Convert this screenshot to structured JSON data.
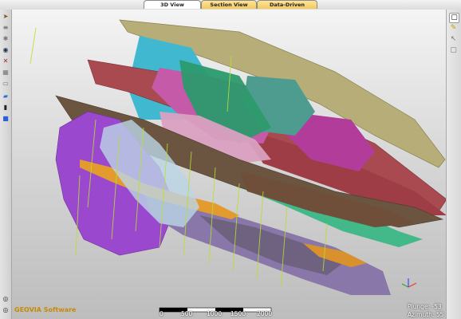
{
  "tabs": [
    {
      "label": "3D View"
    },
    {
      "label": "Section View"
    },
    {
      "label": "Data-Driven Modelling"
    }
  ],
  "brand": {
    "name": "GEOVIA Software"
  },
  "scale": {
    "labels": [
      "0",
      "500",
      "1000",
      "1500",
      "2000"
    ]
  },
  "view": {
    "plunge_label": "Plunge",
    "plunge_value": "-53",
    "azimuth_label": "Azimuth",
    "azimuth_value": "55"
  },
  "colors": {
    "accent_tab": "#f3c95a",
    "brand": "#c88a00"
  },
  "icons": {
    "left": [
      "select-arrow-icon",
      "layers-icon",
      "settings-icon",
      "eye-icon",
      "axis-icon",
      "grid-icon",
      "box-icon",
      "chat-icon",
      "book-icon",
      "stop-icon"
    ],
    "right": [
      "window-icon",
      "pencil-icon",
      "pointer-icon",
      "frame-icon"
    ]
  }
}
